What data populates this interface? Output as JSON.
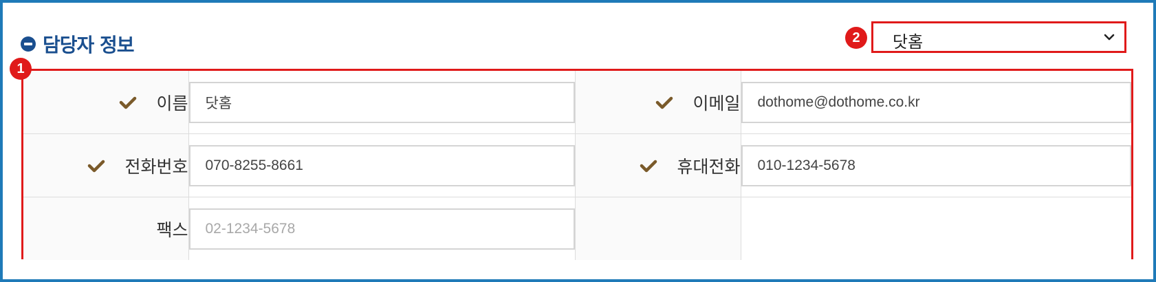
{
  "section": {
    "title": "담당자 정보"
  },
  "annotations": {
    "badge1": "1",
    "badge2": "2"
  },
  "select": {
    "value": "닷홈"
  },
  "fields": {
    "name": {
      "label": "이름",
      "value": "닷홈"
    },
    "email": {
      "label": "이메일",
      "value": "dothome@dothome.co.kr"
    },
    "phone": {
      "label": "전화번호",
      "value": "070-8255-8661"
    },
    "mobile": {
      "label": "휴대전화",
      "value": "010-1234-5678"
    },
    "fax": {
      "label": "팩스",
      "placeholder": "02-1234-5678"
    }
  },
  "colors": {
    "title": "#1a4f8f",
    "frame": "#1f7ab8",
    "highlight": "#e01a1a",
    "check": "#7a5a2a"
  },
  "icons": {
    "section": "minus-circle-icon",
    "required": "check-icon",
    "select": "chevron-down-icon"
  }
}
